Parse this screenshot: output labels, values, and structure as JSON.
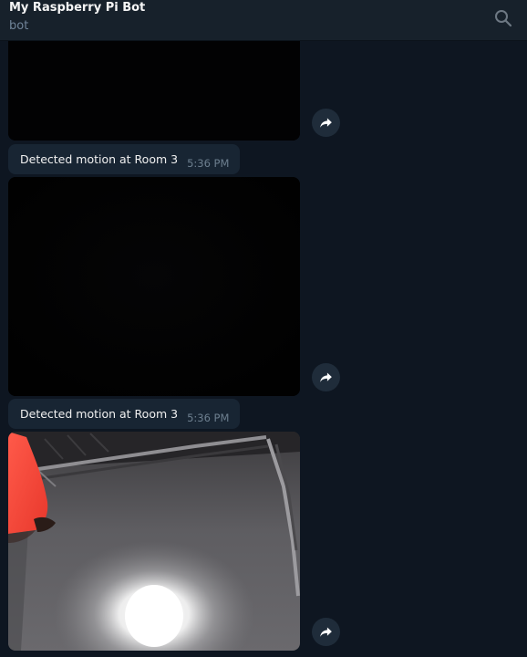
{
  "header": {
    "title": "My Raspberry Pi Bot",
    "subtitle": "bot",
    "search_icon": "search-icon"
  },
  "messages": [
    {
      "type": "photo",
      "content": "dark camera frame",
      "forward_icon": "forward-icon"
    },
    {
      "type": "text",
      "text": "Detected motion at Room 3",
      "time": "5:36 PM"
    },
    {
      "type": "photo",
      "content": "dark camera frame",
      "forward_icon": "forward-icon"
    },
    {
      "type": "text",
      "text": "Detected motion at Room 3",
      "time": "5:36 PM"
    },
    {
      "type": "photo",
      "content": "ceiling with light and red shirt",
      "forward_icon": "forward-icon"
    }
  ],
  "colors": {
    "background": "#0e1621",
    "header": "#17212b",
    "bubble": "#182533",
    "time": "#6d7f8f",
    "forward_button": "#1f2c3a"
  }
}
